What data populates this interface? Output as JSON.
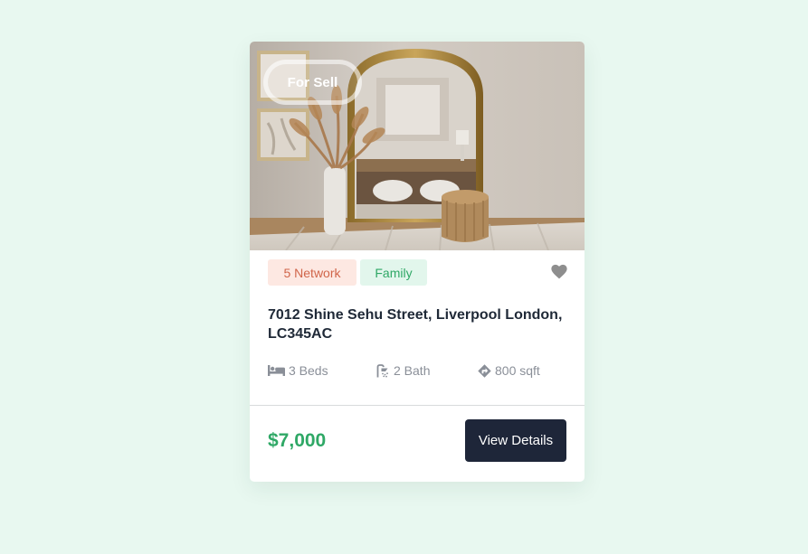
{
  "listing": {
    "status_badge": "For Sell",
    "tags": [
      "5 Network",
      "Family"
    ],
    "address": "7012 Shine Sehu Street, Liverpool London, LC345AC",
    "features": {
      "beds": "3 Beds",
      "bath": "2 Bath",
      "area": "800 sqft"
    },
    "price": "$7,000",
    "details_button": "View Details"
  },
  "icons": {
    "favorite": "heart-icon",
    "beds": "bed-icon",
    "bath": "shower-icon",
    "area": "direction-sign-icon"
  },
  "colors": {
    "background": "#e8f8f0",
    "price": "#2fa866",
    "button": "#1e2639",
    "tag_network_bg": "#fde8e2",
    "tag_network_text": "#d0654a",
    "tag_family_bg": "#e2f6ec",
    "tag_family_text": "#2fa866"
  }
}
